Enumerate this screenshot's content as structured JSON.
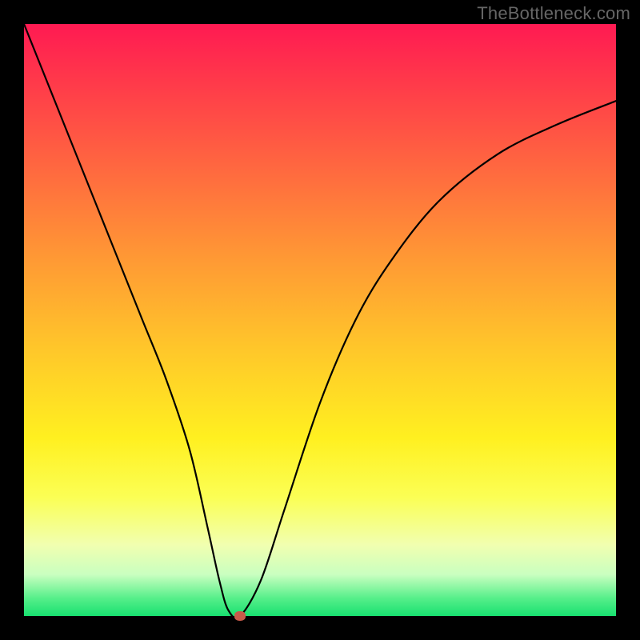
{
  "watermark": "TheBottleneck.com",
  "chart_data": {
    "type": "line",
    "title": "",
    "xlabel": "",
    "ylabel": "",
    "xlim": [
      0,
      100
    ],
    "ylim": [
      0,
      100
    ],
    "grid": false,
    "series": [
      {
        "name": "bottleneck-curve",
        "x": [
          0,
          4,
          8,
          12,
          16,
          20,
          24,
          28,
          31,
          33,
          34.5,
          36.5,
          40,
          44,
          50,
          56,
          62,
          70,
          80,
          90,
          100
        ],
        "values": [
          100,
          90,
          80,
          70,
          60,
          50,
          40,
          28,
          15,
          6,
          1,
          0,
          6,
          18,
          36,
          50,
          60,
          70,
          78,
          83,
          87
        ]
      }
    ],
    "annotations": [
      {
        "name": "minimum-marker",
        "x": 36.5,
        "y": 0
      }
    ],
    "background": {
      "type": "vertical-gradient",
      "stops": [
        {
          "pct": 0,
          "color": "#ff1a52"
        },
        {
          "pct": 25,
          "color": "#ff6a3f"
        },
        {
          "pct": 55,
          "color": "#ffc72a"
        },
        {
          "pct": 80,
          "color": "#fbff55"
        },
        {
          "pct": 97,
          "color": "#56ef8a"
        },
        {
          "pct": 100,
          "color": "#18e070"
        }
      ]
    }
  }
}
